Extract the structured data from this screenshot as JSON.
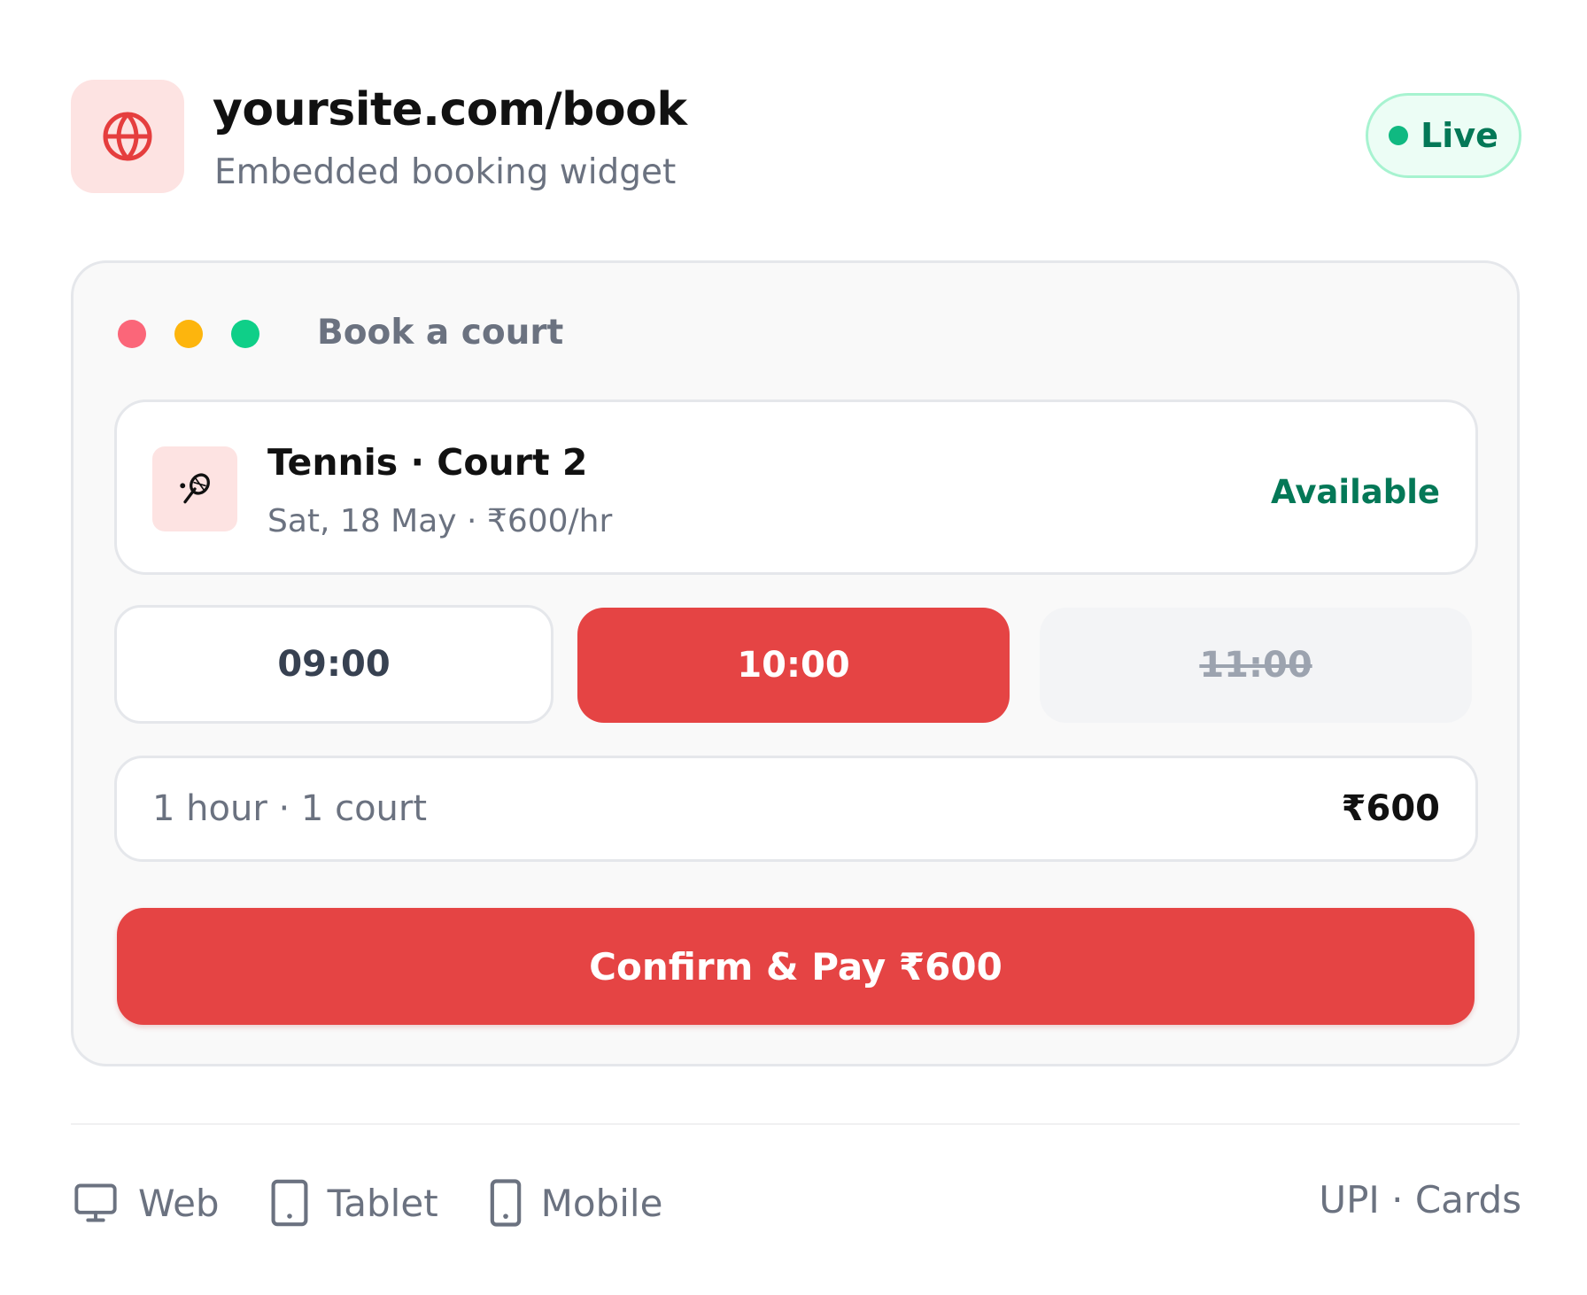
{
  "header": {
    "icon": "globe-icon",
    "title": "yoursite.com/book",
    "subtitle": "Embedded booking widget",
    "status_badge": "Live",
    "status_color": "#10b981"
  },
  "widget": {
    "window_title": "Book a court",
    "court": {
      "icon": "tennis-racket-icon",
      "name": "Tennis · Court 2",
      "meta": "Sat, 18 May · ₹600/hr",
      "status": "Available"
    },
    "time_slots": [
      {
        "label": "09:00",
        "state": "available"
      },
      {
        "label": "10:00",
        "state": "selected"
      },
      {
        "label": "11:00",
        "state": "unavailable"
      }
    ],
    "summary": {
      "label": "1 hour · 1 court",
      "amount": "₹600"
    },
    "confirm_button": "Confirm & Pay ₹600"
  },
  "footer": {
    "platforms": [
      {
        "icon": "monitor-icon",
        "label": "Web"
      },
      {
        "icon": "tablet-icon",
        "label": "Tablet"
      },
      {
        "icon": "mobile-icon",
        "label": "Mobile"
      }
    ],
    "payment_methods": "UPI · Cards"
  },
  "colors": {
    "accent": "#e54444",
    "accent_soft": "#fde3e2",
    "success": "#047857"
  }
}
